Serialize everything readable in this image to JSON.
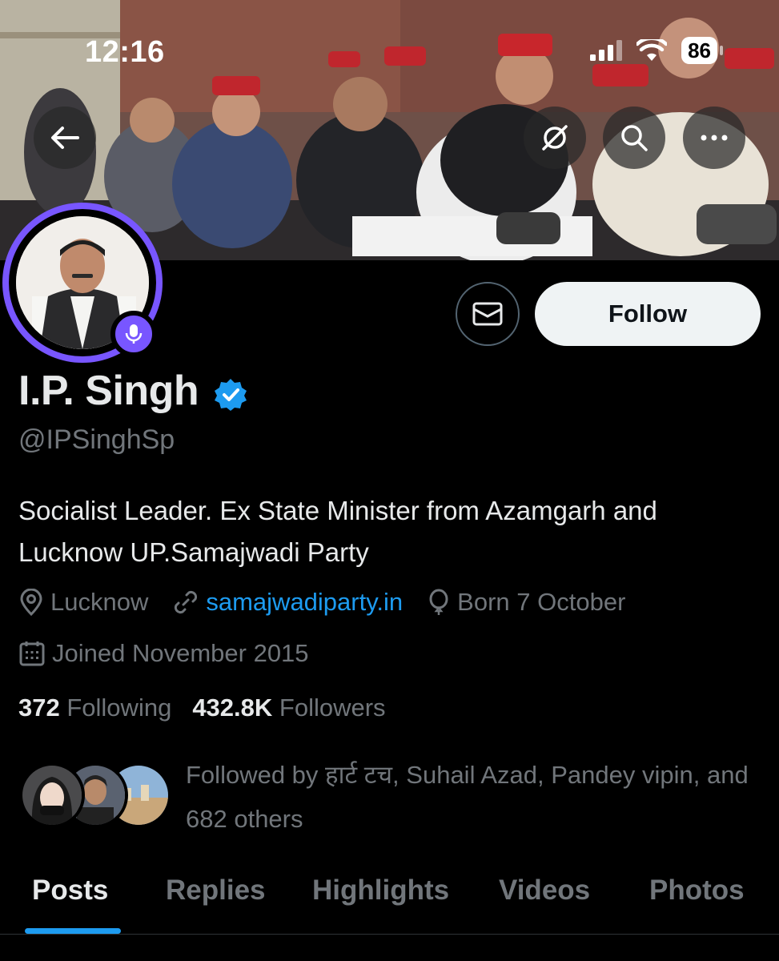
{
  "status_bar": {
    "time": "12:16",
    "battery": "86",
    "icons": [
      "signal-icon",
      "wifi-icon",
      "battery-icon"
    ]
  },
  "header": {
    "back_icon": "arrow-left-icon",
    "buttons": [
      "grok-icon",
      "search-icon",
      "more-icon"
    ]
  },
  "profile": {
    "display_name": "I.P. Singh",
    "handle": "@IPSinghSp",
    "bio": "Socialist Leader. Ex State Minister from Azamgarh and Lucknow UP.Samajwadi Party",
    "location": "Lucknow",
    "website": "samajwadiparty.in",
    "birthday": "Born 7 October",
    "joined": "Joined November 2015",
    "following_count": "372",
    "following_label": "Following",
    "followers_count": "432.8K",
    "followers_label": "Followers",
    "followed_by": "Followed by हार्ट टच, Suhail Azad, Pandey vipin, and 682 others"
  },
  "actions": {
    "follow_label": "Follow",
    "message_icon": "envelope-icon"
  },
  "tabs": [
    "Posts",
    "Replies",
    "Highlights",
    "Videos",
    "Photos"
  ],
  "colors": {
    "accent": "#1d9bf0",
    "avatar_ring": "#7856ff",
    "verified": "#1d9bf0",
    "muted": "#71767b"
  }
}
